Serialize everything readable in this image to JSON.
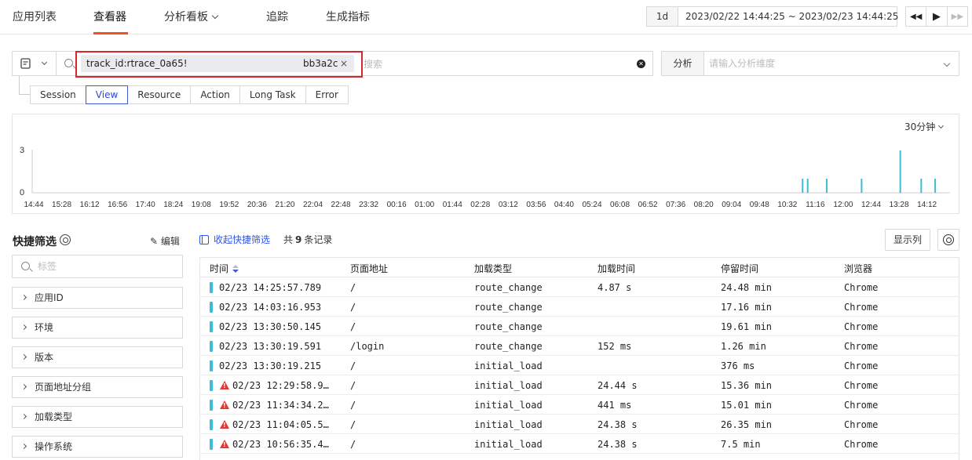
{
  "nav": {
    "items": [
      "应用列表",
      "查看器",
      "分析看板",
      "追踪",
      "生成指标"
    ],
    "active": "查看器"
  },
  "time": {
    "range_button": "1d",
    "range_text": "2023/02/22 14:44:25 ~ 2023/02/23 14:44:25",
    "controls": [
      "rewind-icon",
      "play-icon",
      "fast-forward-icon"
    ]
  },
  "search": {
    "tag_prefix": "track_id:rtrace_0a65!",
    "tag_suffix": "bb3a2c",
    "tag_close": "×",
    "placeholder": "搜索",
    "clear_icon": "close-circle-icon"
  },
  "analysis": {
    "label": "分析",
    "placeholder": "请输入分析维度"
  },
  "type_tabs": {
    "items": [
      "Session",
      "View",
      "Resource",
      "Action",
      "Long Task",
      "Error"
    ],
    "active": "View"
  },
  "chart_data": {
    "type": "bar",
    "interval_label": "30分钟",
    "y_ticks": [
      "0",
      "3"
    ],
    "ylim": [
      0,
      3
    ],
    "x_labels": [
      "14:44",
      "15:28",
      "16:12",
      "16:56",
      "17:40",
      "18:24",
      "19:08",
      "19:52",
      "20:36",
      "21:20",
      "22:04",
      "22:48",
      "23:32",
      "00:16",
      "01:00",
      "01:44",
      "02:28",
      "03:12",
      "03:56",
      "04:40",
      "05:24",
      "06:08",
      "06:52",
      "07:36",
      "08:20",
      "09:04",
      "09:48",
      "10:32",
      "11:16",
      "12:00",
      "12:44",
      "13:28",
      "14:12"
    ],
    "bars": [
      {
        "time": "10:56",
        "value": 1
      },
      {
        "time": "11:04",
        "value": 1
      },
      {
        "time": "11:34",
        "value": 1
      },
      {
        "time": "12:29",
        "value": 1
      },
      {
        "time": "13:30",
        "value": 3
      },
      {
        "time": "14:03",
        "value": 1
      },
      {
        "time": "14:25",
        "value": 1
      }
    ],
    "color": "#3dbcd8"
  },
  "quick_filter": {
    "title": "快捷筛选",
    "edit_label": "编辑",
    "search_placeholder": "标签",
    "facets": [
      "应用ID",
      "环境",
      "版本",
      "页面地址分组",
      "加载类型",
      "操作系统"
    ]
  },
  "results": {
    "collapse_label": "收起快捷筛选",
    "count_prefix": "共",
    "count": "9",
    "count_suffix": "条记录",
    "columns_button": "显示列"
  },
  "table": {
    "columns": [
      "时间",
      "页面地址",
      "加载类型",
      "加载时间",
      "停留时间",
      "浏览器"
    ],
    "rows": [
      {
        "time": "02/23 14:25:57.789",
        "path": "/",
        "load_type": "route_change",
        "load_time": "4.87 s",
        "stay": "24.48 min",
        "browser": "Chrome",
        "error": false
      },
      {
        "time": "02/23 14:03:16.953",
        "path": "/",
        "load_type": "route_change",
        "load_time": "",
        "stay": "17.16 min",
        "browser": "Chrome",
        "error": false
      },
      {
        "time": "02/23 13:30:50.145",
        "path": "/",
        "load_type": "route_change",
        "load_time": "",
        "stay": "19.61 min",
        "browser": "Chrome",
        "error": false
      },
      {
        "time": "02/23 13:30:19.591",
        "path": "/login",
        "load_type": "route_change",
        "load_time": "152 ms",
        "stay": "1.26 min",
        "browser": "Chrome",
        "error": false
      },
      {
        "time": "02/23 13:30:19.215",
        "path": "/",
        "load_type": "initial_load",
        "load_time": "",
        "stay": "376 ms",
        "browser": "Chrome",
        "error": false
      },
      {
        "time": "02/23 12:29:58.9…",
        "path": "/",
        "load_type": "initial_load",
        "load_time": "24.44 s",
        "stay": "15.36 min",
        "browser": "Chrome",
        "error": true
      },
      {
        "time": "02/23 11:34:34.2…",
        "path": "/",
        "load_type": "initial_load",
        "load_time": "441 ms",
        "stay": "15.01 min",
        "browser": "Chrome",
        "error": true
      },
      {
        "time": "02/23 11:04:05.5…",
        "path": "/",
        "load_type": "initial_load",
        "load_time": "24.38 s",
        "stay": "26.35 min",
        "browser": "Chrome",
        "error": true
      },
      {
        "time": "02/23 10:56:35.4…",
        "path": "/",
        "load_type": "initial_load",
        "load_time": "24.38 s",
        "stay": "7.5 min",
        "browser": "Chrome",
        "error": true
      }
    ]
  }
}
